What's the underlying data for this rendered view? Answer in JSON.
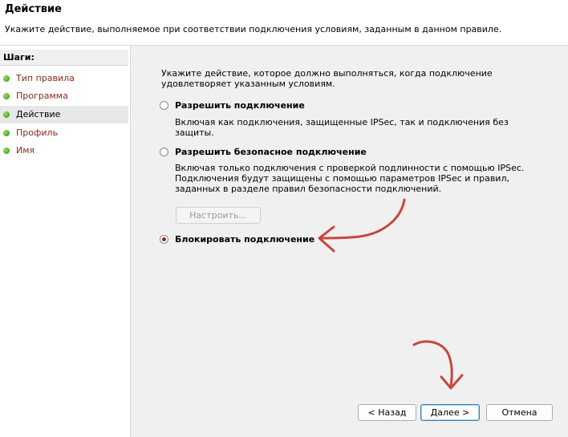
{
  "header": {
    "title": "Действие",
    "description": "Укажите действие, выполняемое при соответствии подключения условиям, заданным в данном правиле."
  },
  "steps": {
    "title": "Шаги:",
    "items": [
      {
        "label": "Тип правила"
      },
      {
        "label": "Программа"
      },
      {
        "label": "Действие",
        "active": true
      },
      {
        "label": "Профиль"
      },
      {
        "label": "Имя"
      }
    ]
  },
  "main": {
    "intro": "Укажите действие, которое должно выполняться, когда подключение удовлетворяет указанным условиям.",
    "options": [
      {
        "label": "Разрешить подключение",
        "description": "Включая как подключения, защищенные IPSec, так и подключения без защиты.",
        "selected": false
      },
      {
        "label": "Разрешить безопасное подключение",
        "description": "Включая только подключения с проверкой подлинности с помощью IPSec. Подключения будут защищены с помощью параметров IPSec и правил, заданных в разделе правил безопасности подключений.",
        "selected": false
      },
      {
        "label": "Блокировать подключение",
        "selected": true
      }
    ],
    "customize_button": "Настроить..."
  },
  "footer": {
    "back_button": "< Назад",
    "next_button": "Далее >",
    "cancel_button": "Отмена"
  },
  "colors": {
    "annotation_arrow": "#c8473c",
    "step_link": "#8a2a1a",
    "panel_background": "#f0f0f0"
  }
}
